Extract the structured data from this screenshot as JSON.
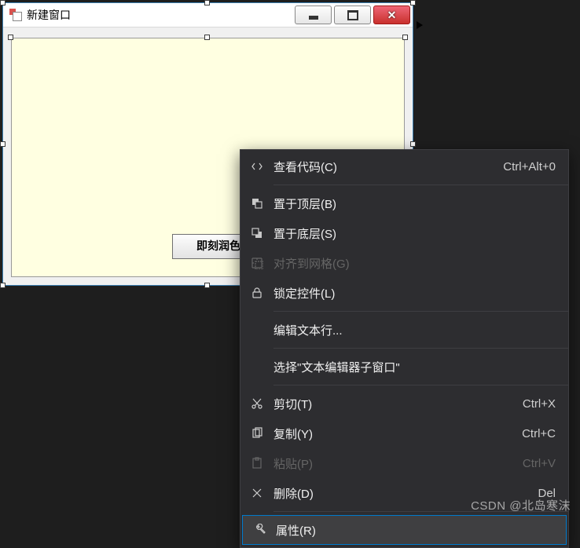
{
  "window": {
    "title": "新建窗口",
    "button_label": "即刻润色"
  },
  "context_menu": {
    "items": [
      {
        "icon": "code-icon",
        "label": "查看代码(C)",
        "shortcut": "Ctrl+Alt+0",
        "enabled": true
      },
      {
        "sep": true
      },
      {
        "icon": "bring-front-icon",
        "label": "置于顶层(B)",
        "shortcut": "",
        "enabled": true
      },
      {
        "icon": "send-back-icon",
        "label": "置于底层(S)",
        "shortcut": "",
        "enabled": true
      },
      {
        "icon": "grid-icon",
        "label": "对齐到网格(G)",
        "shortcut": "",
        "enabled": false
      },
      {
        "icon": "lock-icon",
        "label": "锁定控件(L)",
        "shortcut": "",
        "enabled": true
      },
      {
        "sep": true
      },
      {
        "icon": "",
        "label": "编辑文本行...",
        "shortcut": "",
        "enabled": true
      },
      {
        "sep": true
      },
      {
        "icon": "",
        "label": "选择\"文本编辑器子窗口\"",
        "shortcut": "",
        "enabled": true
      },
      {
        "sep": true
      },
      {
        "icon": "cut-icon",
        "label": "剪切(T)",
        "shortcut": "Ctrl+X",
        "enabled": true
      },
      {
        "icon": "copy-icon",
        "label": "复制(Y)",
        "shortcut": "Ctrl+C",
        "enabled": true
      },
      {
        "icon": "paste-icon",
        "label": "粘贴(P)",
        "shortcut": "Ctrl+V",
        "enabled": false
      },
      {
        "icon": "delete-icon",
        "label": "删除(D)",
        "shortcut": "Del",
        "enabled": true
      },
      {
        "sep": true
      },
      {
        "icon": "wrench-icon",
        "label": "属性(R)",
        "shortcut": "",
        "enabled": true,
        "highlight": true
      }
    ]
  },
  "watermark": "CSDN @北岛寒沫"
}
